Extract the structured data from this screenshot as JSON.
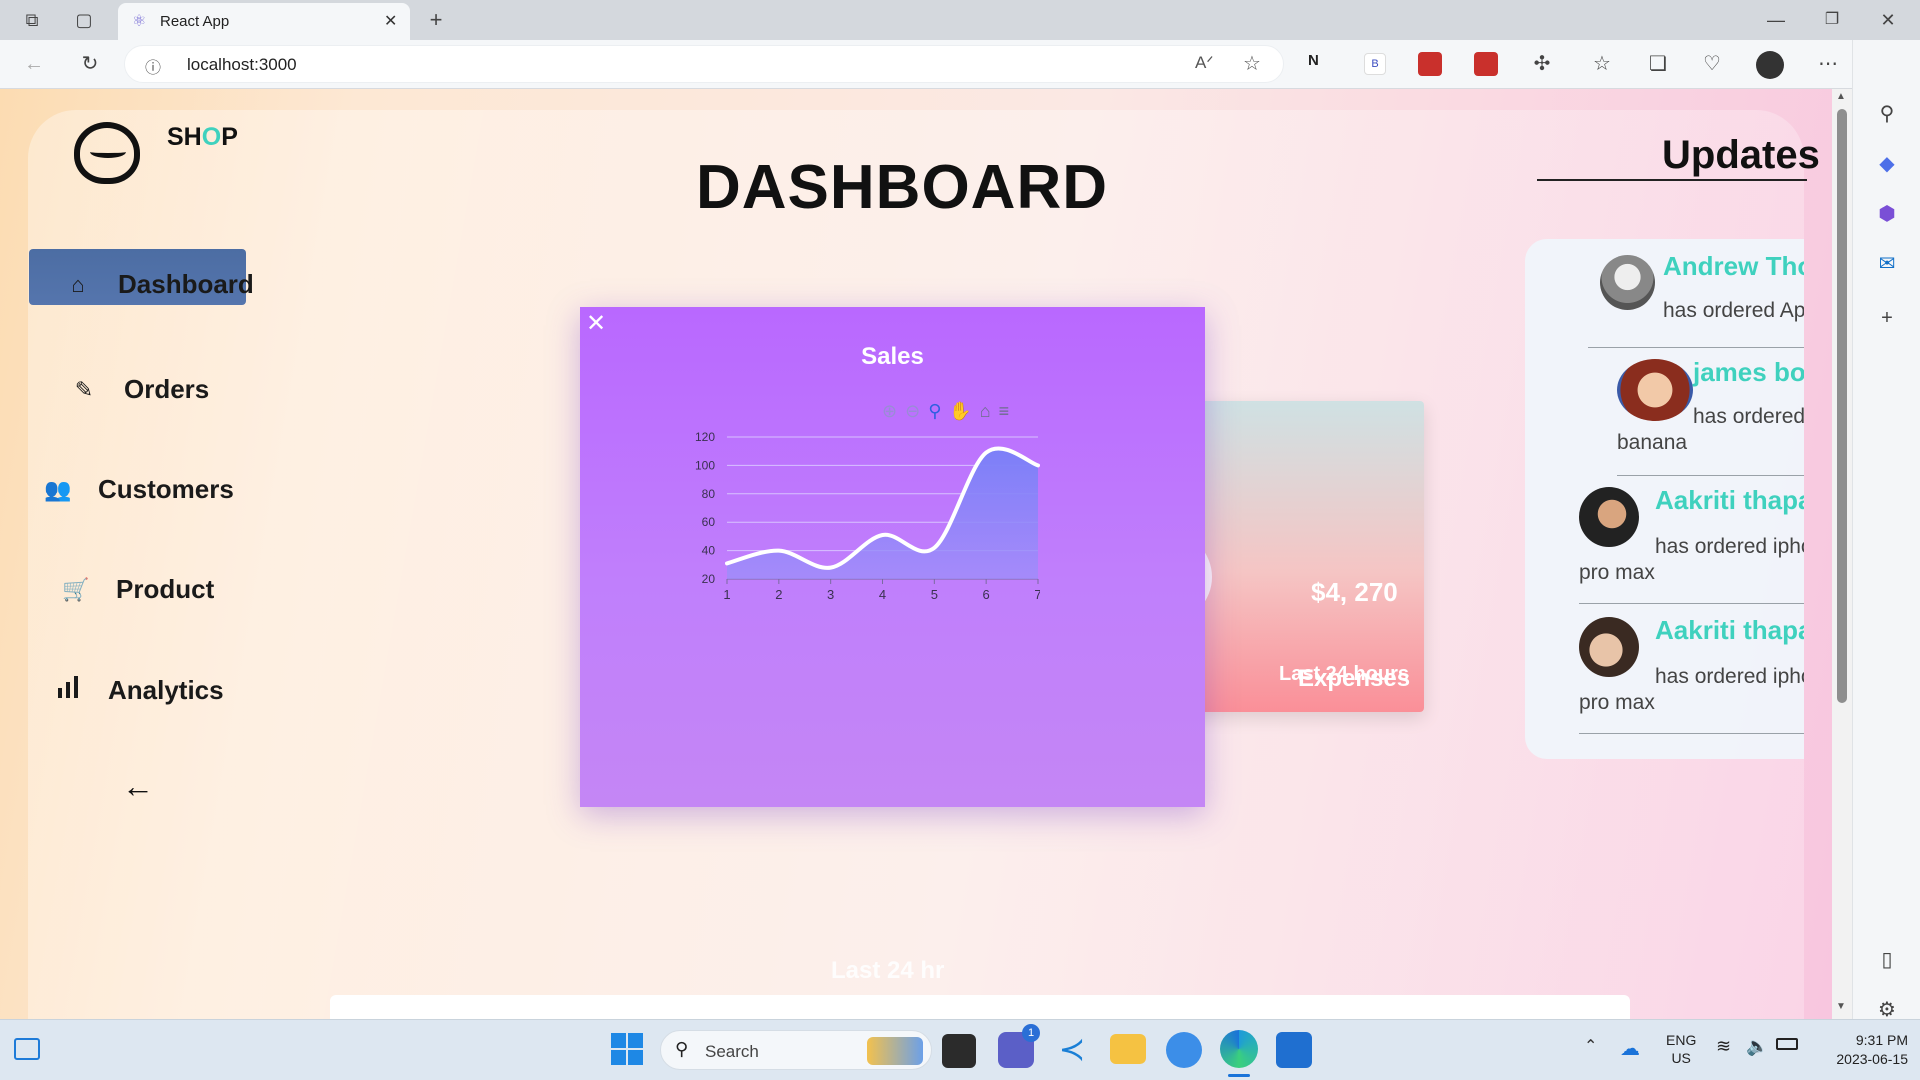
{
  "browser": {
    "tab_title": "React App",
    "url": "localhost:3000"
  },
  "sidebar": {
    "brand": {
      "prefix": "SH",
      "accent": "O",
      "suffix": "P"
    },
    "items": [
      {
        "label": "Dashboard",
        "icon": "home-icon"
      },
      {
        "label": "Orders",
        "icon": "clipboard-icon"
      },
      {
        "label": "Customers",
        "icon": "users-icon"
      },
      {
        "label": "Product",
        "icon": "cart-icon"
      },
      {
        "label": "Analytics",
        "icon": "bar-chart-icon"
      }
    ],
    "collapse_arrow": "←"
  },
  "main": {
    "title": "DASHBOARD",
    "card_back": {
      "amount": "$4, 270",
      "label1": "Last 24 hours",
      "label2": "Expenses"
    },
    "bottom_caption": "Last 24 hr"
  },
  "modal": {
    "close": "✕",
    "title": "Sales"
  },
  "chart_data": {
    "type": "area",
    "title": "Sales",
    "x": [
      1,
      2,
      3,
      4,
      5,
      6,
      7
    ],
    "series": [
      {
        "values": [
          31,
          40,
          28,
          51,
          42,
          109,
          100
        ]
      }
    ],
    "xlim": [
      1,
      7
    ],
    "ylim": [
      20,
      120
    ],
    "yticks": [
      20,
      40,
      60,
      80,
      100,
      120
    ],
    "grid": true,
    "colors": {
      "fill_top": "#7b7ff8",
      "fill_bottom": "#9c8ef9",
      "line": "#ffffff"
    }
  },
  "updates": {
    "heading": "Updates",
    "items": [
      {
        "name": "Andrew Thomas",
        "text": "has ordered Apple smart watch"
      },
      {
        "name": "james bond",
        "text": "has ordered",
        "text2": "banana"
      },
      {
        "name": "Aakriti thapa",
        "text": "has ordered iphone",
        "text2": "pro max"
      },
      {
        "name": "Aakriti thapa",
        "text": "has ordered iphone",
        "text2": "pro max"
      }
    ]
  },
  "taskbar": {
    "search_placeholder": "Search",
    "lang": "ENG",
    "region": "US",
    "time": "9:31 PM",
    "date": "2023-06-15",
    "chat_badge": "1"
  }
}
